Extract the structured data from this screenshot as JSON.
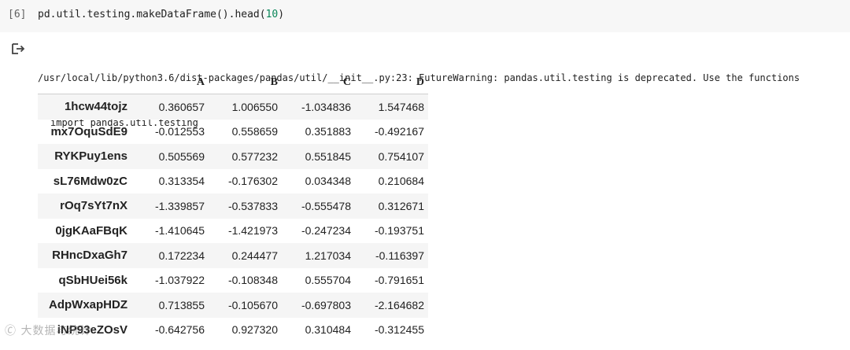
{
  "cell": {
    "prompt": "[6]",
    "code_prefix": "pd.util.testing.makeDataFrame().head(",
    "code_arg": "10",
    "code_suffix": ")"
  },
  "output": {
    "icon": "output-arrow-icon",
    "stderr_line1": "/usr/local/lib/python3.6/dist-packages/pandas/util/__init__.py:23: FutureWarning: pandas.util.testing is deprecated. Use the functions",
    "stderr_line2": "import pandas.util.testing"
  },
  "dataframe": {
    "columns": [
      "A",
      "B",
      "C",
      "D"
    ],
    "rows": [
      {
        "index": "1hcw44tojz",
        "values": [
          "0.360657",
          "1.006550",
          "-1.034836",
          "1.547468"
        ]
      },
      {
        "index": "mx7OquSdE9",
        "values": [
          "-0.012553",
          "0.558659",
          "0.351883",
          "-0.492167"
        ]
      },
      {
        "index": "RYKPuy1ens",
        "values": [
          "0.505569",
          "0.577232",
          "0.551845",
          "0.754107"
        ]
      },
      {
        "index": "sL76Mdw0zC",
        "values": [
          "0.313354",
          "-0.176302",
          "0.034348",
          "0.210684"
        ]
      },
      {
        "index": "rOq7sYt7nX",
        "values": [
          "-1.339857",
          "-0.537833",
          "-0.555478",
          "0.312671"
        ]
      },
      {
        "index": "0jgKAaFBqK",
        "values": [
          "-1.410645",
          "-1.421973",
          "-0.247234",
          "-0.193751"
        ]
      },
      {
        "index": "RHncDxaGh7",
        "values": [
          "0.172234",
          "0.244477",
          "1.217034",
          "-0.116397"
        ]
      },
      {
        "index": "qSbHUei56k",
        "values": [
          "-1.037922",
          "-0.108348",
          "0.555704",
          "-0.791651"
        ]
      },
      {
        "index": "AdpWxapHDZ",
        "values": [
          "0.713855",
          "-0.105670",
          "-0.697803",
          "-2.164682"
        ]
      },
      {
        "index": "iNP93eZOsV",
        "values": [
          "-0.642756",
          "0.927320",
          "0.310484",
          "-0.312455"
        ]
      }
    ]
  },
  "watermark": "大数据与统计"
}
